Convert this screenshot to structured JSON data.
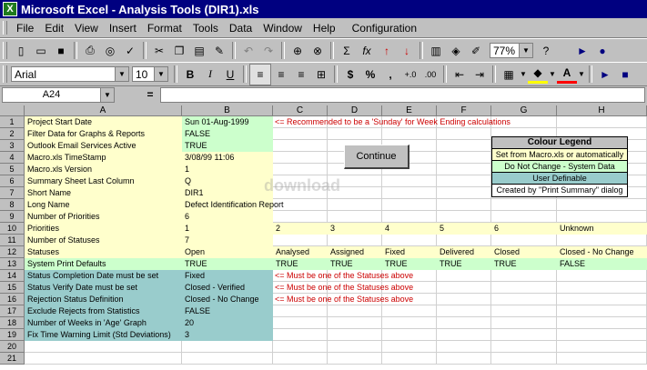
{
  "window": {
    "title": "Microsoft Excel - Analysis Tools (DIR1).xls",
    "app_icon": "X"
  },
  "menu": [
    "File",
    "Edit",
    "View",
    "Insert",
    "Format",
    "Tools",
    "Data",
    "Window",
    "Help",
    "Configuration"
  ],
  "toolbar": {
    "zoom": "77%",
    "font": "Arial",
    "font_size": "10",
    "bold": "B",
    "italic": "I",
    "underline": "U",
    "currency": "$",
    "percent": "%",
    "comma": ",",
    "sum": "Σ",
    "fx": "fx",
    "inc_decimal": "+.0",
    "dec_decimal": ".00",
    "dec_indent": "⇤",
    "inc_indent": "⇥"
  },
  "formula_bar": {
    "name_box": "A24",
    "equals": "="
  },
  "columns": [
    "A",
    "B",
    "C",
    "D",
    "E",
    "F",
    "G",
    "H"
  ],
  "rows": [
    {
      "n": "1",
      "a": "Project Start Date",
      "b": "Sun 01-Aug-1999",
      "note": "<= Recommended to be a 'Sunday' for Week Ending calculations"
    },
    {
      "n": "2",
      "a": "Filter Data for Graphs & Reports",
      "b": "FALSE"
    },
    {
      "n": "3",
      "a": "Outlook Email Services Active",
      "b": "TRUE"
    },
    {
      "n": "4",
      "a": "Macro.xls TimeStamp",
      "b": "3/08/99 11:06"
    },
    {
      "n": "5",
      "a": "Macro.xls Version",
      "b": "1"
    },
    {
      "n": "6",
      "a": "Summary Sheet Last Column",
      "b": "Q"
    },
    {
      "n": "7",
      "a": "Short Name",
      "b": "DIR1"
    },
    {
      "n": "8",
      "a": "Long Name",
      "b": "Defect Identification Report"
    },
    {
      "n": "9",
      "a": "Number of Priorities",
      "b": "6"
    },
    {
      "n": "10",
      "a": "Priorities",
      "b": "1",
      "ext": [
        "2",
        "3",
        "4",
        "5",
        "6",
        "Unknown"
      ]
    },
    {
      "n": "11",
      "a": "Number of Statuses",
      "b": "7"
    },
    {
      "n": "12",
      "a": "Statuses",
      "b": "Open",
      "ext": [
        "Analysed",
        "Assigned",
        "Fixed",
        "Delivered",
        "Closed",
        "Closed - No Change"
      ]
    },
    {
      "n": "13",
      "a": "System Print Defaults",
      "b": "TRUE",
      "ext": [
        "TRUE",
        "TRUE",
        "TRUE",
        "TRUE",
        "TRUE",
        "FALSE",
        "TRU"
      ]
    },
    {
      "n": "14",
      "a": "Status Completion Date must be set",
      "b": "Fixed",
      "note": "<= Must be one of the Statuses above"
    },
    {
      "n": "15",
      "a": "Status Verify Date must be set",
      "b": "Closed - Verified",
      "note": "<= Must be one of the Statuses above"
    },
    {
      "n": "16",
      "a": "Rejection Status Definition",
      "b": "Closed - No Change",
      "note": "<= Must be one of the Statuses above"
    },
    {
      "n": "17",
      "a": "Exclude Rejects from Statistics",
      "b": "FALSE"
    },
    {
      "n": "18",
      "a": "Number of Weeks in 'Age' Graph",
      "b": "20"
    },
    {
      "n": "19",
      "a": "Fix Time Warning Limit (Std Deviations)",
      "b": "3"
    },
    {
      "n": "20"
    },
    {
      "n": "21"
    }
  ],
  "legend": {
    "title": "Colour Legend",
    "items": [
      "Set from Macro.xls or automatically",
      "Do Not Change - System Data",
      "User Definable",
      "Created by \"Print Summary\" dialog"
    ]
  },
  "continue_button": "Continue",
  "watermark": "download",
  "colors": {
    "yellow": "#ffffcc",
    "green": "#ccffcc",
    "teal": "#99cccc",
    "note_red": "#cc0000",
    "title_blue": "#000080"
  }
}
